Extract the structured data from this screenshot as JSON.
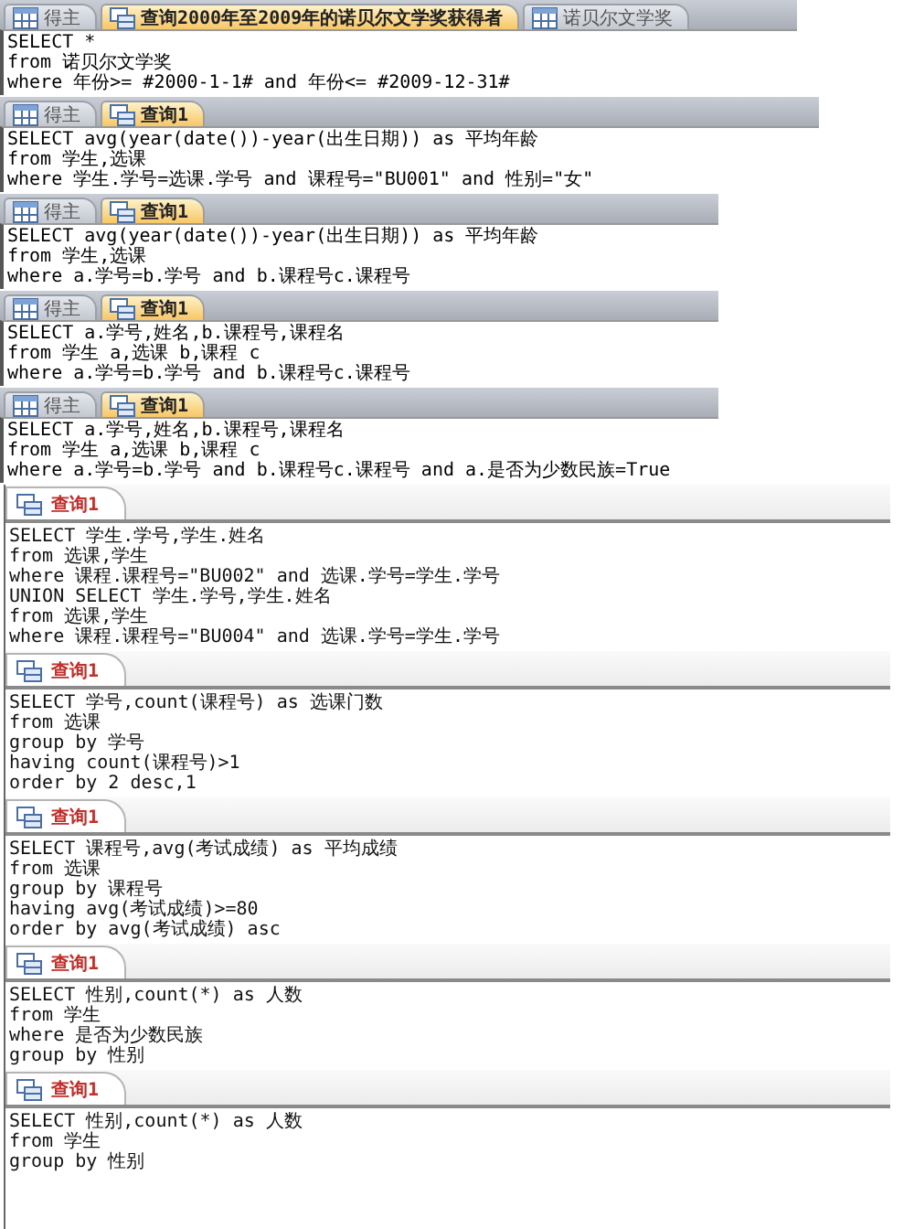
{
  "panels": [
    {
      "kind": "classic",
      "tabs": [
        {
          "label": "得主",
          "kind": "table",
          "selected": false
        },
        {
          "label": "查询2000年至2009年的诺贝尔文学奖获得者",
          "kind": "query",
          "selected": true
        },
        {
          "label": "诺贝尔文学奖",
          "kind": "table",
          "selected": false
        }
      ],
      "lines": [
        "SELECT *",
        "from 诺贝尔文学奖",
        "where 年份>= #2000-1-1# and 年份<= #2009-12-31#"
      ]
    },
    {
      "kind": "classic",
      "tabs": [
        {
          "label": "得主",
          "kind": "table",
          "selected": false
        },
        {
          "label": "查询1",
          "kind": "query",
          "selected": true
        }
      ],
      "lines": [
        "SELECT avg(year(date())-year(出生日期)) as 平均年龄",
        "from 学生,选课",
        "where 学生.学号=选课.学号 and 课程号=\"BU001\" and 性别=\"女\""
      ]
    },
    {
      "kind": "classic",
      "tabs": [
        {
          "label": "得主",
          "kind": "table",
          "selected": false
        },
        {
          "label": "查询1",
          "kind": "query",
          "selected": true
        }
      ],
      "lines": [
        "SELECT avg(year(date())-year(出生日期)) as 平均年龄",
        "from 学生,选课",
        "where a.学号=b.学号 and b.课程号c.课程号"
      ]
    },
    {
      "kind": "classic",
      "tabs": [
        {
          "label": "得主",
          "kind": "table",
          "selected": false
        },
        {
          "label": "查询1",
          "kind": "query",
          "selected": true
        }
      ],
      "lines": [
        "SELECT a.学号,姓名,b.课程号,课程名",
        "from 学生 a,选课 b,课程 c",
        "where a.学号=b.学号 and b.课程号c.课程号"
      ]
    },
    {
      "kind": "classic",
      "tabs": [
        {
          "label": "得主",
          "kind": "table",
          "selected": false
        },
        {
          "label": "查询1",
          "kind": "query",
          "selected": true
        }
      ],
      "lines": [
        "SELECT a.学号,姓名,b.课程号,课程名",
        "from 学生 a,选课 b,课程 c",
        "where a.学号=b.学号 and b.课程号c.课程号 and a.是否为少数民族=True"
      ]
    },
    {
      "kind": "ribbon",
      "tabs": [
        {
          "label": "查询1",
          "kind": "query",
          "selected": true
        }
      ],
      "lines": [
        "SELECT 学生.学号,学生.姓名",
        "from 选课,学生",
        "where 课程.课程号=\"BU002\" and 选课.学号=学生.学号",
        "UNION SELECT 学生.学号,学生.姓名",
        "from 选课,学生",
        "where 课程.课程号=\"BU004\" and 选课.学号=学生.学号"
      ]
    },
    {
      "kind": "ribbon",
      "tabs": [
        {
          "label": "查询1",
          "kind": "query",
          "selected": true
        }
      ],
      "lines": [
        "SELECT 学号,count(课程号) as 选课门数",
        "from 选课",
        "group by 学号",
        "having count(课程号)>1",
        "order by 2 desc,1"
      ]
    },
    {
      "kind": "ribbon",
      "tabs": [
        {
          "label": "查询1",
          "kind": "query",
          "selected": true
        }
      ],
      "lines": [
        "SELECT 课程号,avg(考试成绩) as 平均成绩",
        "from 选课",
        "group by 课程号",
        "having avg(考试成绩)>=80",
        "order by avg(考试成绩) asc"
      ]
    },
    {
      "kind": "ribbon",
      "tabs": [
        {
          "label": "查询1",
          "kind": "query",
          "selected": true
        }
      ],
      "lines": [
        "SELECT 性别,count(*) as 人数",
        "from 学生",
        "where 是否为少数民族",
        "group by 性别"
      ]
    },
    {
      "kind": "ribbon",
      "tabs": [
        {
          "label": "查询1",
          "kind": "query",
          "selected": true
        }
      ],
      "lines": [
        "SELECT 性别,count(*) as 人数",
        "from 学生",
        "group by 性别"
      ]
    }
  ]
}
